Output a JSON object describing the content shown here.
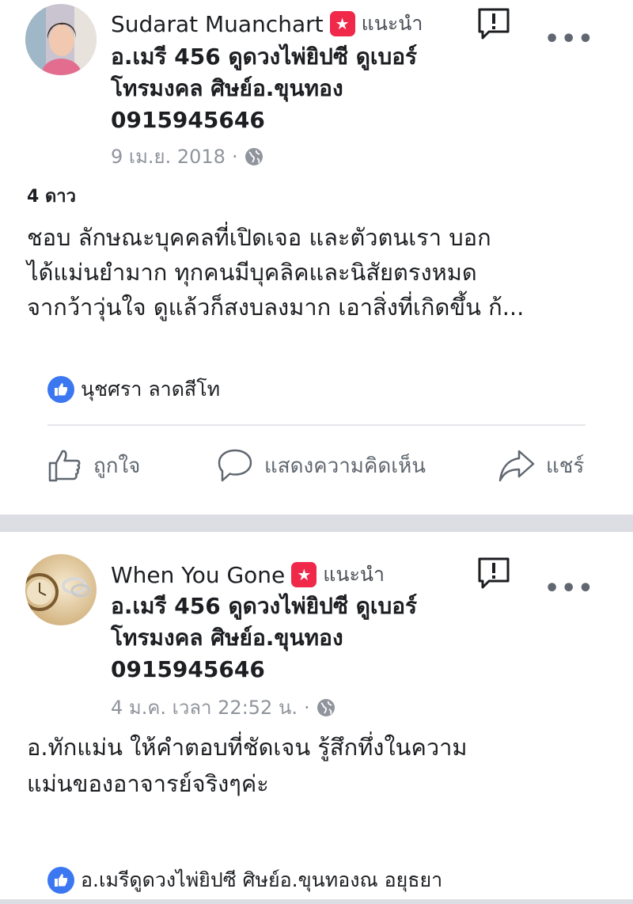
{
  "posts": [
    {
      "author": "Sudarat Muanchart",
      "recommend_label": "แนะนำ",
      "page_lines": [
        "อ.เมรี 456 ดูดวงไพ่ยิปซี ดูเบอร์",
        "โทรมงคล ศิษย์อ.ขุนทอง",
        "0915945646"
      ],
      "date": "9 เม.ย. 2018",
      "separator": "·",
      "privacy_icon": "globe-icon",
      "rating": "4 ดาว",
      "review_lines": [
        "ชอบ ลักษณะบุคคลที่เปิดเจอ และตัวตนเรา บอก",
        "ได้แม่นยำมาก ทุกคนมีบุคลิคและนิสัยตรงหมด",
        "จากว้าวุ่นใจ ดูแล้วก็สงบลงมาก เอาสิ่งที่เกิดขึ้น ก้..."
      ],
      "liked_by": "นุชศรา ลาดสีโท",
      "actions": {
        "like": "ถูกใจ",
        "comment": "แสดงความคิดเห็น",
        "share": "แชร์"
      }
    },
    {
      "author": "When You Gone",
      "recommend_label": "แนะนำ",
      "page_lines": [
        "อ.เมรี 456 ดูดวงไพ่ยิปซี ดูเบอร์",
        "โทรมงคล ศิษย์อ.ขุนทอง",
        "0915945646"
      ],
      "date": "4 ม.ค. เวลา 22:52 น.",
      "separator": "·",
      "privacy_icon": "globe-icon",
      "review_lines": [
        "อ.ทักแม่น ให้คำตอบที่ชัดเจน รู้สึกทึ่งในความ",
        "แม่นของอาจารย์จริงๆค่ะ"
      ],
      "liked_by": "อ.เมรีดูดวงไพ่ยิปซี ศิษย์อ.ขุนทองณ อยุธยา"
    }
  ],
  "colors": {
    "badge": "#f02849",
    "like_blue": "#3b77f0",
    "muted": "#90949c",
    "separator_band": "#dcdee3"
  },
  "more_label": "•••"
}
